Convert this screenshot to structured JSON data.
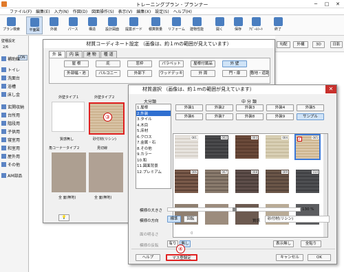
{
  "app": {
    "title": "トレーニングプラン - プランナー"
  },
  "menu": [
    "ファイル(F)",
    "編集(E)",
    "入力(N)",
    "作図(D)",
    "図面操作(S)",
    "表示(V)",
    "編集(X)",
    "設定(S)",
    "ヘルプ(H)"
  ],
  "toolbar": [
    "プラン検索",
    "平面図",
    "外装",
    "パース",
    "構造",
    "設計図面",
    "提案ボード",
    "積算数量",
    "リフォーム",
    "建物性能",
    "開く",
    "保存",
    "ｱﾋﾟｰﾙｼｰﾄ",
    "終了"
  ],
  "toolbar_right": [
    "勾配",
    "外構",
    "3D",
    "日影"
  ],
  "sidebar": {
    "header": "壁種設定",
    "page": "2/6",
    "on": "ON",
    "items": [
      "補助線",
      "トイレ",
      "洗面台",
      "浴槽",
      "床し金",
      "玄関収納",
      "台所用",
      "階段用",
      "子供用",
      "寝室用",
      "和室用",
      "屋外用",
      "その他",
      "AM部品"
    ]
  },
  "dlg1": {
    "caption": "材質コーディネート設定 （画像は、約１ｍの範囲が見えています）",
    "tabs": [
      "外 装",
      "内 装",
      "建 物",
      "種 道"
    ],
    "row1": [
      "屋 根",
      "庇",
      "窓枠",
      "パラペット",
      "屋根付属品",
      "外 壁"
    ],
    "row2": [
      "外部幅・池",
      "バルコニー",
      "外部下",
      "ウッドデッキ",
      "外 周",
      "門・扉",
      "敷地・道路"
    ],
    "cells": [
      "外壁タイプ１",
      "外壁タイプ２",
      "質感無し",
      "砂付材(リシン)",
      "角コーナータイプ２",
      "見切線",
      "全 面(無地)",
      "全 面(無地)"
    ]
  },
  "dlg2": {
    "caption": "材質選択 （画像は、約１ｍの範囲が見えています）",
    "cat_label": "大分類",
    "mid_label": "中 分 類",
    "cats": [
      "1.屋根",
      "2.外装",
      "3.タイル",
      "4.木目",
      "5.床材",
      "6.クロス",
      "7.金属・石",
      "8.その他",
      "9.カラー",
      "10.和",
      "11.図面背景",
      "12.プレミアム"
    ],
    "mids": [
      "外装1",
      "外装2",
      "外装3",
      "外装4",
      "外装5",
      "外装6",
      "外装7",
      "外装8",
      "外装9",
      "サンプル"
    ],
    "tiles": [
      "001",
      "002",
      "003",
      "004",
      "005",
      "006",
      "007",
      "008",
      "009",
      "010"
    ],
    "size_label": "模様の大きさ",
    "size_value": "130 %",
    "dir_label": "模様の方向",
    "dir_std": "標準",
    "dir_rot": "回転",
    "finish_label": "質感",
    "finish_value": "砂付材(リシン)",
    "gloss_label": "面の明るさ",
    "gloss_value": "0",
    "rev_label": "模様の反転",
    "rev_on": "有り",
    "rev_off": "無し",
    "disp_btn": "表示無し",
    "copy_btn": "全貼り",
    "help": "ヘルプ",
    "mass": "マス登録定",
    "cancel": "キャンセル",
    "ok": "OK"
  },
  "badges": [
    "③",
    "④"
  ]
}
